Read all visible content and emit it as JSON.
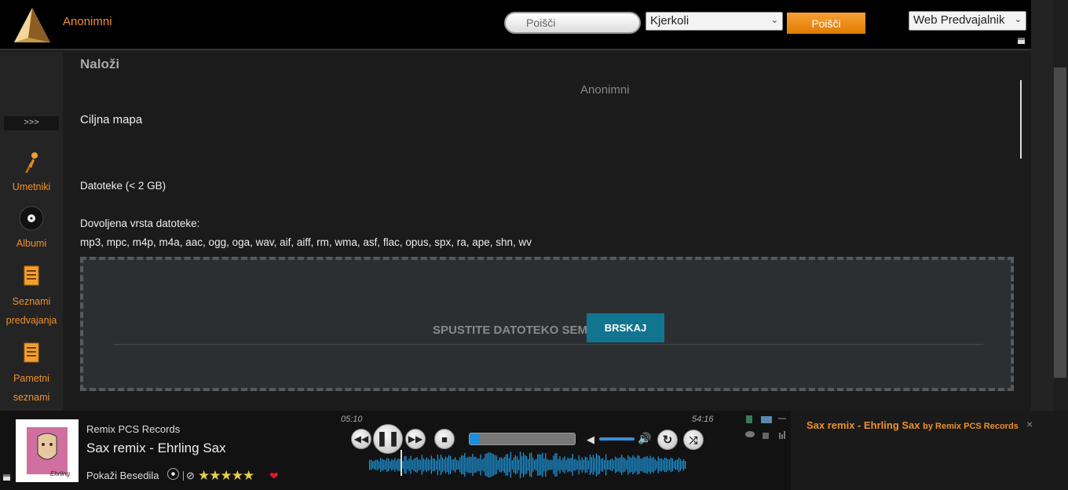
{
  "header": {
    "username": "Anonimni",
    "search_placeholder": "Poišči",
    "filter_select": "Kjerkoli",
    "search_button": "Poišči",
    "player_select": "Web Predvajalnik"
  },
  "sidebar": {
    "toggle": ">>>",
    "items": [
      {
        "label": "Umetniki",
        "icon": "artist-icon"
      },
      {
        "label": "Albumi",
        "icon": "album-icon"
      },
      {
        "label": "Seznami predvajanja",
        "icon": "playlist-icon"
      },
      {
        "label": "Pametni seznami",
        "icon": "smartlist-icon"
      }
    ]
  },
  "upload": {
    "title": "Naloži",
    "owner": "Anonimni",
    "target_folder_label": "Ciljna mapa",
    "files_label": "Datoteke (< 2 GB)",
    "allowed_label": "Dovoljena vrsta datoteke:",
    "allowed_types": "mp3, mpc, m4p, m4a, aac, ogg, oga, wav, aif, aiff, rm, wma, asf, flac, opus, spx, ra, ape, shn, wv",
    "drop_text": "SPUSTITE DATOTEKO SEM",
    "browse_button": "BRSKAJ"
  },
  "player": {
    "artist": "Remix PCS Records",
    "track": "Sax remix - Ehrling Sax",
    "lyrics_link": "Pokaži Besedila",
    "elapsed": "05:10",
    "total": "54:16",
    "rating": 5,
    "stars": "★★★★★",
    "progress": 0.09,
    "volume": 0.6,
    "cover_text": "Ehrling"
  },
  "now_playing": {
    "title": "Sax remix - Ehrling Sax",
    "by": "by Remix PCS Records",
    "close": "×"
  },
  "colors": {
    "accent": "#f0902a",
    "browse": "#117590",
    "progress": "#1a8fe0",
    "waveform": "#1e9ee8"
  }
}
